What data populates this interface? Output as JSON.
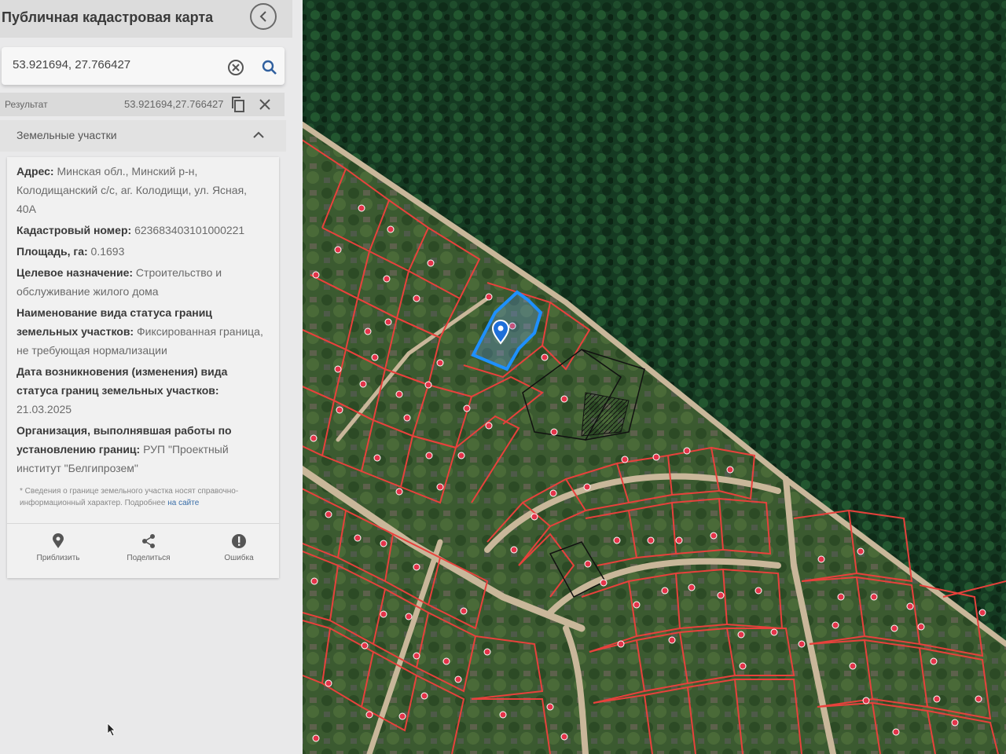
{
  "header": {
    "title": "Публичная кадастровая карта"
  },
  "search": {
    "value": "53.921694, 27.766427"
  },
  "result": {
    "label": "Результат",
    "value": "53.921694,27.766427"
  },
  "section": {
    "title": "Земельные участки"
  },
  "parcel": {
    "address_label": "Адрес:",
    "address_value": "Минская обл., Минский р-н, Колодищанский с/с, аг. Колодищи, ул. Ясная, 40А",
    "cadastral_label": "Кадастровый номер:",
    "cadastral_value": "623683403101000221",
    "area_label": "Площадь, га:",
    "area_value": "0.1693",
    "purpose_label": "Целевое назначение:",
    "purpose_value": "Строительство и обслуживание жилого дома",
    "boundary_status_label": "Наименование вида статуса границ земельных участков:",
    "boundary_status_value": "Фиксированная граница, не требующая нормализации",
    "status_date_label": "Дата возникновения (изменения) вида статуса границ земельных участков:",
    "status_date_value": "21.03.2025",
    "organization_label": "Организация, выполнявшая работы по установлению границ:",
    "organization_value": "РУП \"Проектный институт \"Белгипрозем\""
  },
  "note": {
    "text": "* Сведения о границе земельного участка носят справочно-информационный характер. Подробнее",
    "link": "на сайте"
  },
  "actions": [
    {
      "label": "Приблизить",
      "icon": "location-pin-icon"
    },
    {
      "label": "Поделиться",
      "icon": "share-icon"
    },
    {
      "label": "Ошибка",
      "icon": "error-icon"
    }
  ],
  "colors": {
    "parcel_boundary": "#e8413c",
    "selected_parcel": "#1e90ff",
    "forest": "#143620",
    "road": "#c9b79a"
  }
}
